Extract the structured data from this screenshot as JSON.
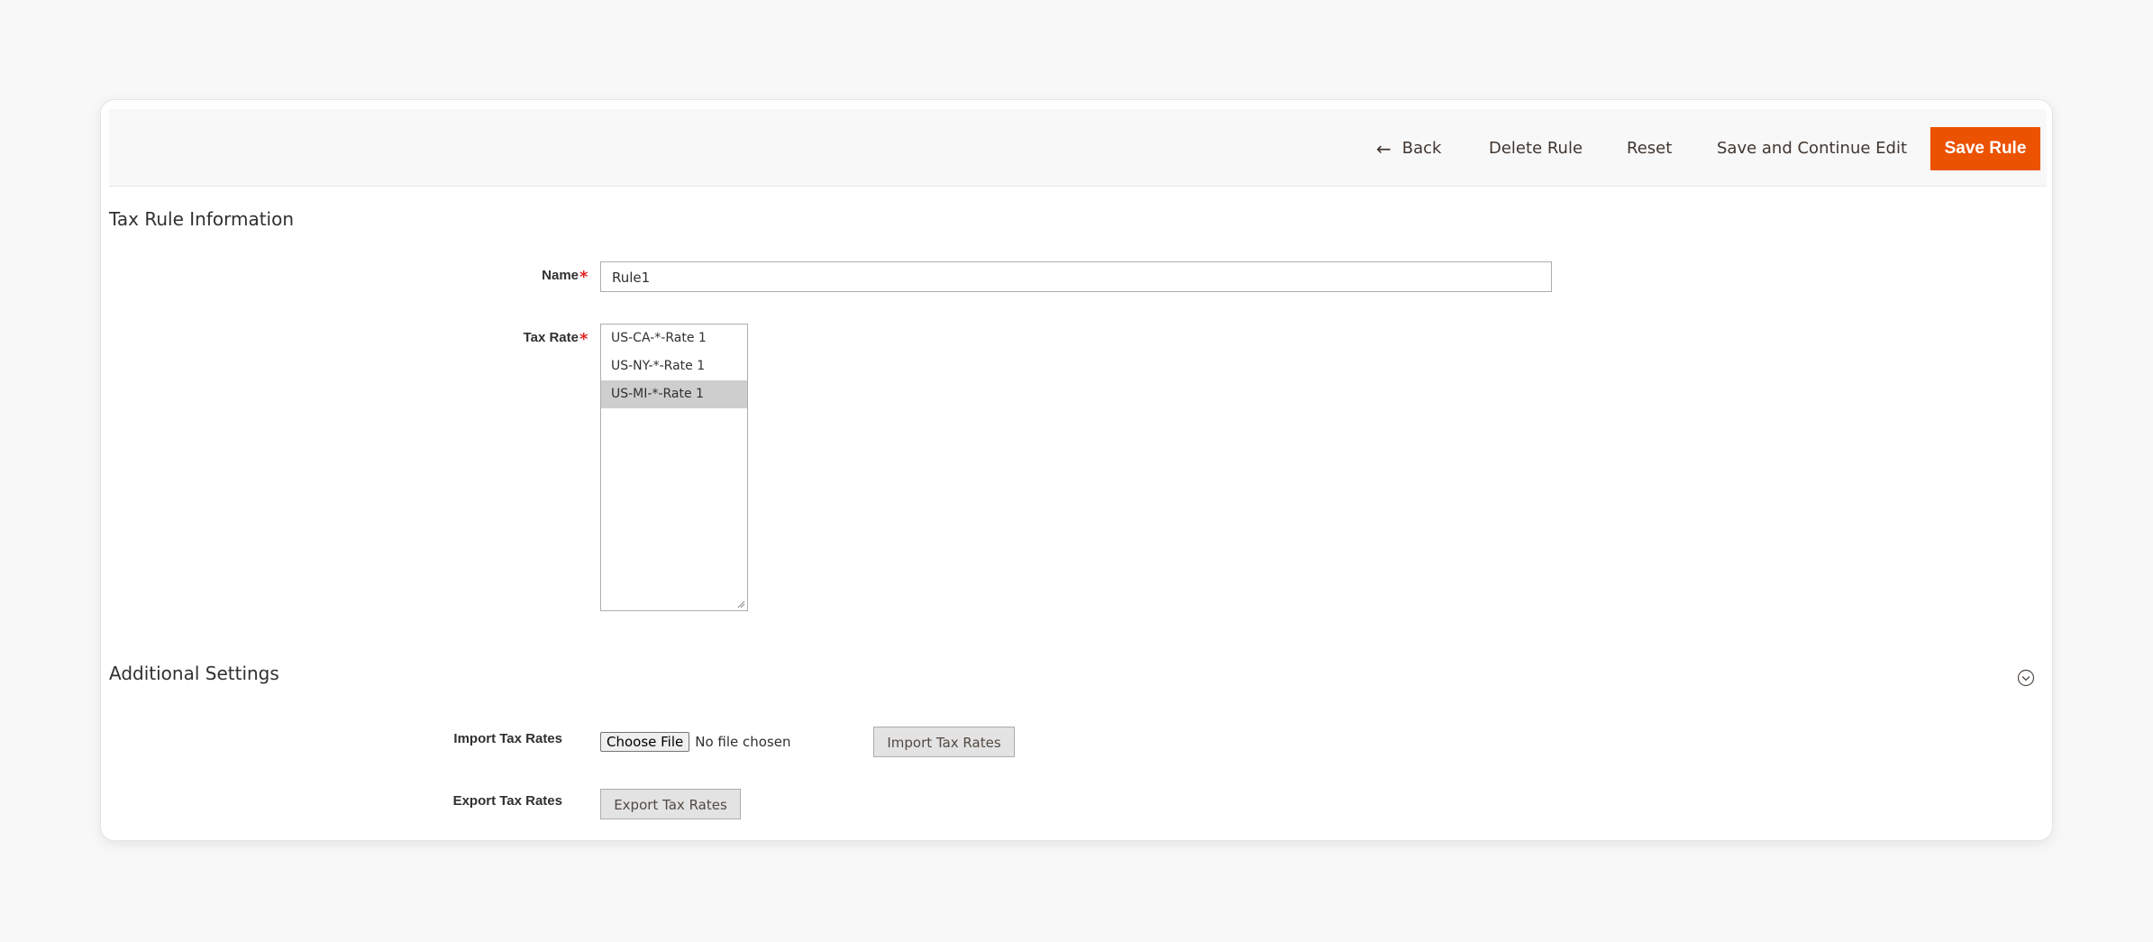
{
  "toolbar": {
    "back_label": "Back",
    "delete_label": "Delete Rule",
    "reset_label": "Reset",
    "save_continue_label": "Save and Continue Edit",
    "save_label": "Save Rule"
  },
  "section_info": {
    "title": "Tax Rule Information",
    "name_label": "Name",
    "name_value": "Rule1",
    "tax_rate_label": "Tax Rate",
    "required_mark": "*",
    "tax_rates": [
      {
        "label": "US-CA-*-Rate 1",
        "selected": false
      },
      {
        "label": "US-NY-*-Rate 1",
        "selected": false
      },
      {
        "label": "US-MI-*-Rate 1",
        "selected": true
      }
    ]
  },
  "section_additional": {
    "title": "Additional Settings",
    "import_label": "Import Tax Rates",
    "choose_file_label": "Choose File",
    "no_file_text": "No file chosen",
    "import_button_label": "Import Tax Rates",
    "export_label": "Export Tax Rates",
    "export_button_label": "Export Tax Rates"
  },
  "icons": {
    "back": "arrow-left-icon",
    "collapse": "chevron-down-circle-icon"
  },
  "colors": {
    "primary_button": "#eb5202",
    "required": "#e22626",
    "selected_row": "#cecece"
  }
}
